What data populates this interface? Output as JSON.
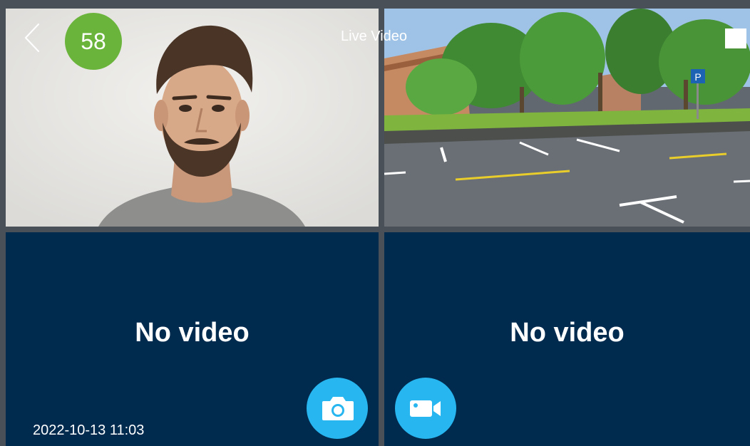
{
  "header": {
    "back_icon": "chevron-left-icon",
    "counter": "58",
    "title": "Live Video",
    "stop_icon": "stop-square-icon"
  },
  "panels": [
    {
      "content": "person-portrait",
      "label": ""
    },
    {
      "content": "parking-lot-street-view",
      "label": ""
    },
    {
      "content": "",
      "label": "No video"
    },
    {
      "content": "",
      "label": "No video"
    }
  ],
  "controls": {
    "snapshot_icon": "camera-icon",
    "record_icon": "video-camera-icon"
  },
  "status": {
    "datetime": "2022-10-13 11:03"
  },
  "colors": {
    "no_video_bg": "#002b4f",
    "counter_bg": "#6ab43b",
    "action_button": "#27b6ef",
    "divider": "#4a5057"
  }
}
